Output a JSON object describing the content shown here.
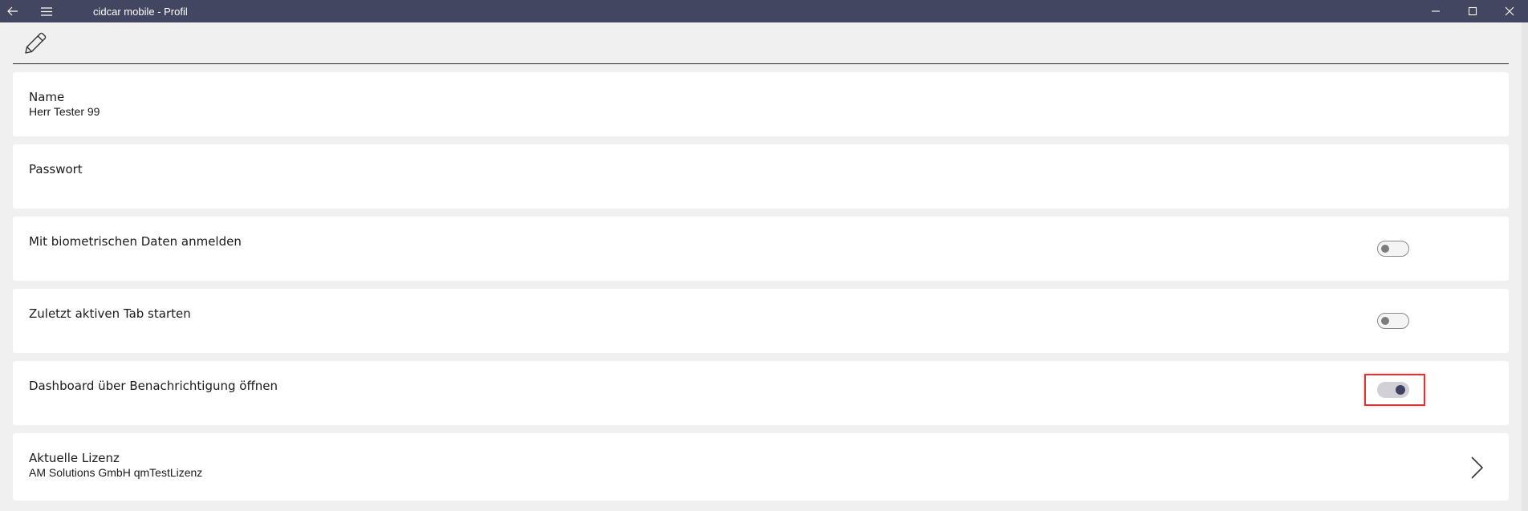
{
  "window": {
    "title": "cidcar mobile - Profil",
    "back_icon": "arrow-left-icon",
    "menu_icon": "hamburger-menu-icon",
    "controls": [
      "minimize-icon",
      "maximize-icon",
      "close-icon"
    ],
    "titlebar_color": "#424660"
  },
  "toolbar": {
    "edit_icon": "pencil-icon"
  },
  "profile": {
    "name": {
      "label": "Name",
      "value": "Herr Tester 99"
    },
    "password": {
      "label": "Passwort",
      "value": ""
    },
    "biometric": {
      "label": "Mit biometrischen Daten anmelden",
      "enabled": false
    },
    "last_tab": {
      "label": "Zuletzt aktiven Tab starten",
      "enabled": false
    },
    "dashboard_notification": {
      "label": "Dashboard über Benachrichtigung öffnen",
      "enabled": true
    },
    "license": {
      "label": "Aktuelle Lizenz",
      "value": "AM Solutions GmbH qmTestLizenz",
      "icon": "chevron-right-icon"
    }
  },
  "colors": {
    "accent": "#3e4260",
    "highlight": "#d23a3a",
    "card": "#ffffff",
    "background": "#f0f0f0"
  }
}
